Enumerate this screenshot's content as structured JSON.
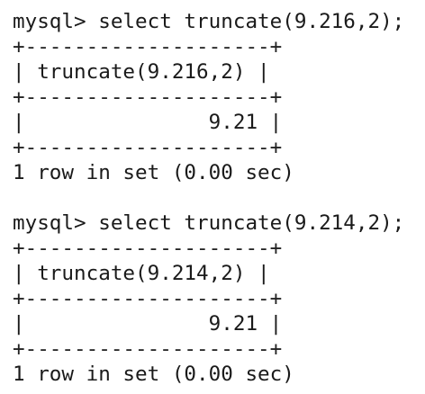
{
  "blocks": [
    {
      "command": "mysql> select truncate(9.216,2);",
      "border": "+--------------------+",
      "header": "| truncate(9.216,2) |",
      "value_row": "|               9.21 |",
      "summary": "1 row in set (0.00 sec)"
    },
    {
      "command": "mysql> select truncate(9.214,2);",
      "border": "+--------------------+",
      "header": "| truncate(9.214,2) |",
      "value_row": "|               9.21 |",
      "summary": "1 row in set (0.00 sec)"
    }
  ]
}
